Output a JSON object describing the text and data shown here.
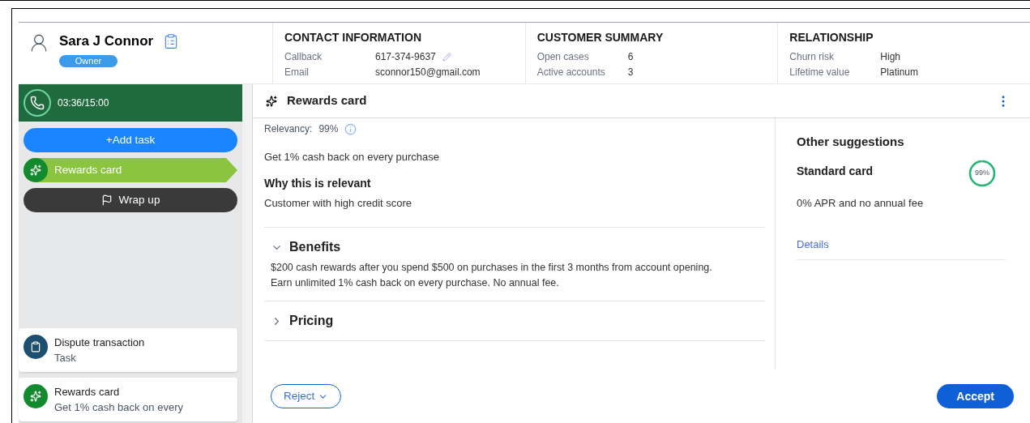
{
  "customer": {
    "name": "Sara J Connor",
    "badge": "Owner"
  },
  "header_sections": [
    {
      "title": "CONTACT INFORMATION",
      "fields": [
        {
          "label": "Callback",
          "value": "617-374-9637",
          "editable": true
        },
        {
          "label": "Email",
          "value": "sconnor150@gmail.com",
          "editable": false
        }
      ]
    },
    {
      "title": "CUSTOMER SUMMARY",
      "fields": [
        {
          "label": "Open cases",
          "value": "6",
          "editable": false
        },
        {
          "label": "Active accounts",
          "value": "3",
          "editable": false
        }
      ]
    },
    {
      "title": "RELATIONSHIP",
      "fields": [
        {
          "label": "Churn risk",
          "value": "High",
          "editable": false
        },
        {
          "label": "Lifetime value",
          "value": "Platinum",
          "editable": false
        }
      ]
    }
  ],
  "call_timer": "03:36/15:00",
  "steps": [
    {
      "kind": "add",
      "label": "+Add task",
      "selected": false
    },
    {
      "kind": "offer",
      "label": "Rewards card",
      "selected": true
    },
    {
      "kind": "wrap",
      "label": "Wrap up",
      "selected": false
    }
  ],
  "tasks": [
    {
      "kind": "task",
      "title": "Dispute transaction",
      "subtitle": "Task"
    },
    {
      "kind": "offer",
      "title": "Rewards card",
      "subtitle": "Get 1% cash back on every"
    }
  ],
  "offer": {
    "title": "Rewards card",
    "relevancy_label": "Relevancy:",
    "relevancy": "99%",
    "summary": "Get 1% cash back on every purchase",
    "why_title": "Why this is relevant",
    "why_text": "Customer with high credit score",
    "sections": [
      {
        "title": "Benefits",
        "expanded": true,
        "text": "$200 cash rewards after you spend $500 on purchases in the first 3 months from account opening. Earn unlimited 1% cash back on every purchase. No annual fee."
      },
      {
        "title": "Pricing",
        "expanded": false
      }
    ]
  },
  "suggestions": {
    "title": "Other suggestions",
    "items": [
      {
        "name": "Standard card",
        "score": "99%",
        "level": 0.99,
        "description": "0% APR and no annual fee",
        "link": "Details"
      }
    ]
  },
  "actions": {
    "reject": "Reject",
    "accept": "Accept"
  }
}
